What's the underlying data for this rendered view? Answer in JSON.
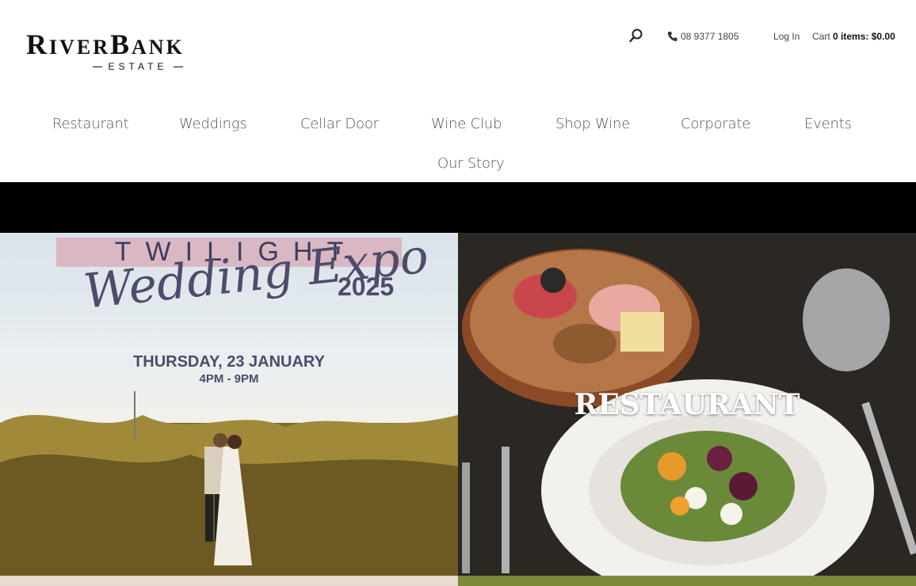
{
  "header": {
    "logo": {
      "main": "RiverBank",
      "sub": "ESTATE"
    },
    "search_icon": "search-icon",
    "phone": "08 9377 1805",
    "login": "Log In",
    "cart": {
      "prefix": "Cart",
      "count": "0 items:",
      "total": "$0.00"
    }
  },
  "nav": [
    {
      "label": "Restaurant"
    },
    {
      "label": "Weddings"
    },
    {
      "label": "Cellar Door"
    },
    {
      "label": "Wine Club"
    },
    {
      "label": "Shop Wine"
    },
    {
      "label": "Corporate"
    },
    {
      "label": "Events"
    },
    {
      "label": "Our Story"
    }
  ],
  "tiles": {
    "expo": {
      "banner": "TWILIGHT",
      "script": "Wedding Expo",
      "year": "2025",
      "date": "THURSDAY, 23 JANUARY",
      "time": "4PM - 9PM"
    },
    "restaurant": {
      "title": "RESTAURANT"
    }
  },
  "colors": {
    "band": "#000000",
    "banner_bg": "#d9b8c4",
    "expo_text": "#4f4b6a"
  }
}
